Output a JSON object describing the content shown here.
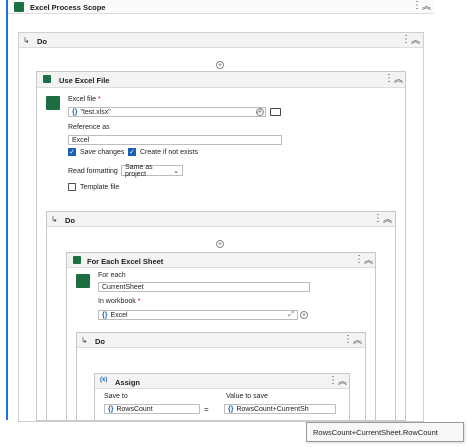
{
  "excel_process_scope": {
    "title": "Excel Process Scope"
  },
  "do_outer": {
    "title": "Do"
  },
  "use_excel_file": {
    "title": "Use Excel File",
    "excel_file_label": "Excel file",
    "required_mark": "*",
    "excel_file_value": "\"test.xlsx\"",
    "reference_as_label": "Reference as",
    "reference_as_value": "Excel",
    "save_changes_label": "Save changes",
    "create_if_not_exists_label": "Create if not exists",
    "read_formatting_label": "Read formatting",
    "read_formatting_value": "Same as project",
    "template_file_label": "Template file"
  },
  "do_inner": {
    "title": "Do"
  },
  "for_each_sheet": {
    "title": "For Each Excel Sheet",
    "for_each_label": "For each",
    "for_each_value": "CurrentSheet",
    "in_workbook_label": "In workbook",
    "required_mark": "*",
    "in_workbook_value": "Excel"
  },
  "do_innermost": {
    "title": "Do"
  },
  "assign": {
    "title": "Assign",
    "icon_text": "(x)",
    "save_to_label": "Save to",
    "save_to_value": "RowsCount",
    "equals": "=",
    "value_to_save_label": "Value to save",
    "value_to_save_value": "RowsCount+CurrentSh"
  },
  "tooltip": {
    "text": "RowsCount+CurrentSheet.RowCount"
  },
  "icons": {
    "curly": "{}",
    "plus": "+",
    "arrow": "↳",
    "vdots": "⋮",
    "collapse": "︽",
    "check": "✓",
    "dropdown": "⌄",
    "expand": "⤢"
  },
  "colors": {
    "accent": "#1a73e8",
    "excel_green": "#1d6f42"
  }
}
